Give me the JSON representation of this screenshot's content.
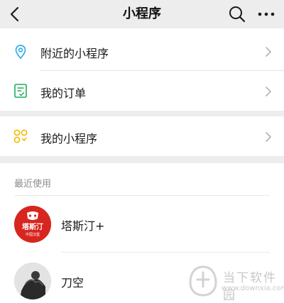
{
  "header": {
    "title": "小程序",
    "back_icon": "chevron-left-icon",
    "search_icon": "search-icon",
    "more_icon": "more-horizontal-icon"
  },
  "menu": [
    {
      "label": "附近的小程序",
      "icon": "location-pin-icon",
      "icon_color": "#2aaee9"
    },
    {
      "label": "我的订单",
      "icon": "order-list-icon",
      "icon_color": "#1aad5a"
    },
    {
      "label": "我的小程序",
      "icon": "mini-program-icon",
      "icon_color": "#f5b800"
    }
  ],
  "recent": {
    "label": "最近使用",
    "items": [
      {
        "name": "塔斯汀+",
        "logo_text": "塔斯汀",
        "logo_sub": "中国汉堡",
        "logo_color": "#d7261f"
      },
      {
        "name": "刀空"
      }
    ]
  },
  "watermark": {
    "text": "当下软件园",
    "url": "www.downxia.com"
  },
  "colors": {
    "background": "#ffffff",
    "section_gap": "#ededed",
    "divider": "#e5e5e5",
    "chevron": "#b2b2b2"
  }
}
